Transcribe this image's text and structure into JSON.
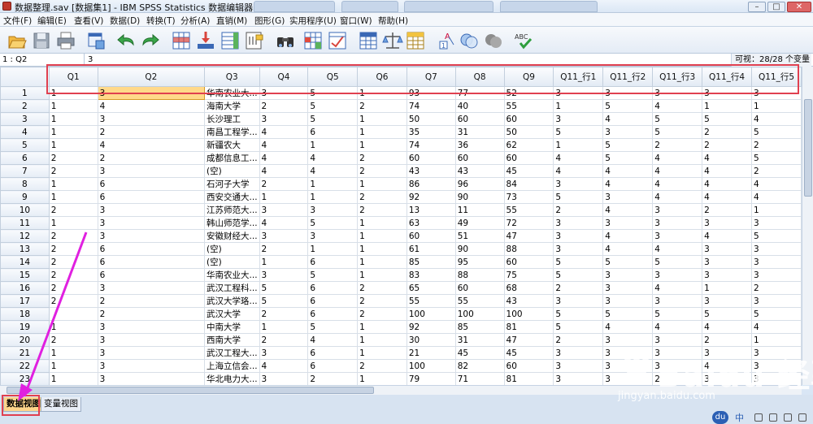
{
  "window": {
    "title": "数据整理.sav [数据集1] - IBM SPSS Statistics 数据编辑器",
    "buttons": [
      "–",
      "□",
      "✕"
    ]
  },
  "menu": [
    "文件(F)",
    "编辑(E)",
    "查看(V)",
    "数据(D)",
    "转换(T)",
    "分析(A)",
    "直销(M)",
    "图形(G)",
    "实用程序(U)",
    "窗口(W)",
    "帮助(H)"
  ],
  "toolbar": {
    "icons": [
      "open-icon",
      "save-icon",
      "print-icon",
      "dialog-recall-icon",
      "undo-icon",
      "redo-icon",
      "goto-case-icon",
      "goto-variable-icon",
      "variables-icon",
      "run-descriptives-icon",
      "find-icon",
      "insert-cases-icon",
      "insert-variable-icon",
      "split-file-icon",
      "weight-cases-icon",
      "select-cases-icon",
      "value-labels-icon",
      "use-sets-icon",
      "show-all-icon",
      "spell-check-icon"
    ],
    "spell_label": "ABC"
  },
  "cell_ref": {
    "name": "1 : Q2",
    "value": "3",
    "visible": "可视：28/28 个变量"
  },
  "columns": [
    "Q1",
    "Q2",
    "Q3",
    "Q4",
    "Q5",
    "Q6",
    "Q7",
    "Q8",
    "Q9",
    "Q11_行1",
    "Q11_行2",
    "Q11_行3",
    "Q11_行4",
    "Q11_行5"
  ],
  "rows": [
    [
      "1",
      "1",
      "3",
      "华南农业大...",
      "3",
      "5",
      "1",
      "93",
      "77",
      "52",
      "3",
      "3",
      "3",
      "3",
      "3"
    ],
    [
      "2",
      "1",
      "4",
      "海南大学",
      "2",
      "5",
      "2",
      "74",
      "40",
      "55",
      "1",
      "5",
      "4",
      "1",
      "1"
    ],
    [
      "3",
      "1",
      "3",
      "长沙理工",
      "3",
      "5",
      "1",
      "50",
      "60",
      "60",
      "3",
      "4",
      "5",
      "5",
      "4"
    ],
    [
      "4",
      "1",
      "2",
      "南昌工程学...",
      "4",
      "6",
      "1",
      "35",
      "31",
      "50",
      "5",
      "3",
      "5",
      "2",
      "5"
    ],
    [
      "5",
      "1",
      "4",
      "新疆农大",
      "4",
      "1",
      "1",
      "74",
      "36",
      "62",
      "1",
      "5",
      "2",
      "2",
      "2"
    ],
    [
      "6",
      "2",
      "2",
      "成都信息工...",
      "4",
      "4",
      "2",
      "60",
      "60",
      "60",
      "4",
      "5",
      "4",
      "4",
      "5"
    ],
    [
      "7",
      "2",
      "3",
      "(空)",
      "4",
      "4",
      "2",
      "43",
      "43",
      "45",
      "4",
      "4",
      "4",
      "4",
      "2"
    ],
    [
      "8",
      "1",
      "6",
      "石河子大学",
      "2",
      "1",
      "1",
      "86",
      "96",
      "84",
      "3",
      "4",
      "4",
      "4",
      "4"
    ],
    [
      "9",
      "1",
      "6",
      "西安交通大...",
      "1",
      "1",
      "2",
      "92",
      "90",
      "73",
      "5",
      "3",
      "4",
      "4",
      "4"
    ],
    [
      "10",
      "2",
      "3",
      "江苏师范大...",
      "3",
      "3",
      "2",
      "13",
      "11",
      "55",
      "2",
      "4",
      "3",
      "2",
      "1"
    ],
    [
      "11",
      "1",
      "3",
      "韩山师范学...",
      "4",
      "5",
      "1",
      "63",
      "49",
      "72",
      "3",
      "3",
      "3",
      "3",
      "3"
    ],
    [
      "12",
      "2",
      "3",
      "安徽财经大...",
      "3",
      "3",
      "1",
      "60",
      "51",
      "47",
      "3",
      "4",
      "3",
      "4",
      "5"
    ],
    [
      "13",
      "2",
      "6",
      "(空)",
      "2",
      "1",
      "1",
      "61",
      "90",
      "88",
      "3",
      "4",
      "4",
      "3",
      "3"
    ],
    [
      "14",
      "2",
      "6",
      "(空)",
      "1",
      "6",
      "1",
      "85",
      "95",
      "60",
      "5",
      "5",
      "5",
      "3",
      "3"
    ],
    [
      "15",
      "2",
      "6",
      "华南农业大...",
      "3",
      "5",
      "1",
      "83",
      "88",
      "75",
      "5",
      "3",
      "3",
      "3",
      "3"
    ],
    [
      "16",
      "2",
      "3",
      "武汉工程科...",
      "5",
      "6",
      "2",
      "65",
      "60",
      "68",
      "2",
      "3",
      "4",
      "1",
      "2"
    ],
    [
      "17",
      "2",
      "2",
      "武汉大学珞...",
      "5",
      "6",
      "2",
      "55",
      "55",
      "43",
      "3",
      "3",
      "3",
      "3",
      "3"
    ],
    [
      "18",
      "",
      "2",
      "武汉大学",
      "2",
      "6",
      "2",
      "100",
      "100",
      "100",
      "5",
      "5",
      "5",
      "5",
      "5"
    ],
    [
      "19",
      "1",
      "3",
      "中南大学",
      "1",
      "5",
      "1",
      "92",
      "85",
      "81",
      "5",
      "4",
      "4",
      "4",
      "4"
    ],
    [
      "20",
      "2",
      "3",
      "西南大学",
      "2",
      "4",
      "1",
      "30",
      "31",
      "47",
      "2",
      "3",
      "3",
      "2",
      "1"
    ],
    [
      "21",
      "1",
      "3",
      "武汉工程大...",
      "3",
      "6",
      "1",
      "21",
      "45",
      "45",
      "3",
      "3",
      "3",
      "3",
      "3"
    ],
    [
      "22",
      "1",
      "3",
      "上海立信会...",
      "4",
      "6",
      "2",
      "100",
      "82",
      "60",
      "3",
      "3",
      "3",
      "4",
      "3"
    ],
    [
      "23",
      "1",
      "3",
      "华北电力大...",
      "3",
      "2",
      "1",
      "79",
      "71",
      "81",
      "3",
      "3",
      "2",
      "3",
      "3"
    ]
  ],
  "view_tabs": {
    "data": "数据视图",
    "variable": "变量视图"
  },
  "watermark": {
    "brand": "Baidu 经验",
    "url": "jingyan.baidu.com"
  },
  "tray": {
    "du": "du",
    "zh": "中"
  },
  "colors": {
    "selected_cell": "#ffd98a",
    "highlight_box": "#e04050",
    "arrow": "#e020e0",
    "data_tab": "#ffd58a"
  }
}
